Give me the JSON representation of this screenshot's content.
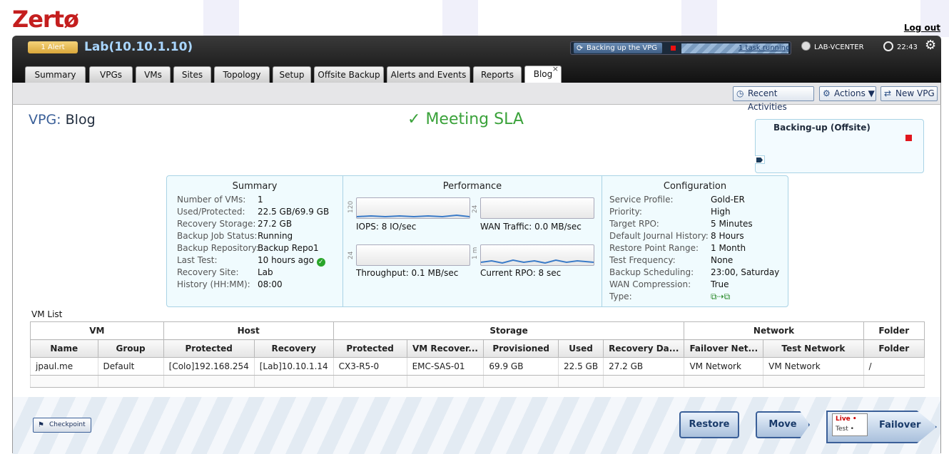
{
  "app": {
    "logo": "Zertø",
    "logout": "Log out"
  },
  "header": {
    "alert": "1 Alert",
    "site": "Lab(10.10.1.10)",
    "backing_label": "Backing up the VPG",
    "task_link": "1 task running",
    "vcenter": "LAB-VCENTER",
    "time": "22:43"
  },
  "tabs": [
    {
      "label": "Summary"
    },
    {
      "label": "VPGs"
    },
    {
      "label": "VMs"
    },
    {
      "label": "Sites"
    },
    {
      "label": "Topology"
    },
    {
      "label": "Setup"
    },
    {
      "label": "Offsite Backup"
    },
    {
      "label": "Alerts and Events"
    },
    {
      "label": "Reports"
    },
    {
      "label": "Blog",
      "active": true
    }
  ],
  "toolbar": {
    "recent": "Recent Activities",
    "actions": "Actions",
    "new_vpg": "New VPG"
  },
  "vpg": {
    "prefix": "VPG:",
    "name": "Blog",
    "sla": "Meeting SLA",
    "status_box": "Backing-up (Offsite)"
  },
  "summary": {
    "title": "Summary",
    "items": [
      {
        "k": "Number of VMs:",
        "v": "1"
      },
      {
        "k": "Used/Protected:",
        "v": "22.5 GB/69.9 GB"
      },
      {
        "k": "Recovery Storage:",
        "v": "27.2 GB"
      },
      {
        "k": "Backup Job Status:",
        "v": "Running"
      },
      {
        "k": "Backup Repository:",
        "v": "Backup Repo1"
      },
      {
        "k": "Last Test:",
        "v": "10 hours ago"
      },
      {
        "k": "Recovery Site:",
        "v": "Lab"
      },
      {
        "k": "History (HH:MM):",
        "v": "08:00"
      }
    ]
  },
  "performance": {
    "title": "Performance",
    "charts": [
      {
        "axis": "120",
        "label": "IOPS: 8 IO/sec"
      },
      {
        "axis": "24",
        "label": "WAN Traffic: 0.0 MB/sec"
      },
      {
        "axis": "24",
        "label": "Throughput: 0.1 MB/sec"
      },
      {
        "axis": "1 m",
        "label": "Current RPO: 8 sec"
      }
    ]
  },
  "configuration": {
    "title": "Configuration",
    "items": [
      {
        "k": "Service Profile:",
        "v": "Gold-ER"
      },
      {
        "k": "Priority:",
        "v": "High"
      },
      {
        "k": "Target RPO:",
        "v": "5 Minutes"
      },
      {
        "k": "Default Journal History:",
        "v": "8 Hours"
      },
      {
        "k": "Restore Point Range:",
        "v": "1 Month"
      },
      {
        "k": "Test Frequency:",
        "v": "None"
      },
      {
        "k": "Backup Scheduling:",
        "v": "23:00, Saturday"
      },
      {
        "k": "WAN Compression:",
        "v": "True"
      },
      {
        "k": "Type:",
        "v": ""
      }
    ]
  },
  "vmlist": {
    "title": "VM List",
    "groups": [
      "VM",
      "Host",
      "Storage",
      "Network",
      "Folder"
    ],
    "columns": [
      "Name",
      "Group",
      "Protected",
      "Recovery",
      "Protected",
      "VM Recover...",
      "Provisioned",
      "Used",
      "Recovery Da...",
      "Failover Net...",
      "Test Network",
      "Folder"
    ],
    "rows": [
      [
        "jpaul.me",
        "Default",
        "[Colo]192.168.254",
        "[Lab]10.10.1.14",
        "CX3-R5-0",
        "EMC-SAS-01",
        "69.9 GB",
        "22.5 GB",
        "27.2 GB",
        "VM Network",
        "VM Network",
        "/"
      ]
    ]
  },
  "actions": {
    "checkpoint": "Checkpoint",
    "restore": "Restore",
    "move": "Move",
    "live": "Live",
    "test": "Test",
    "failover": "Failover"
  }
}
